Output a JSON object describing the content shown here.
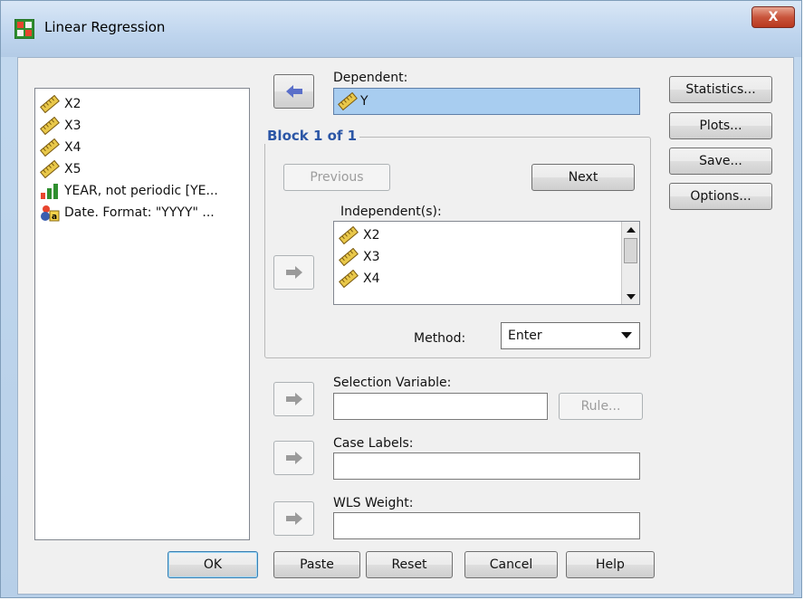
{
  "window": {
    "title": "Linear Regression",
    "close_glyph": "X"
  },
  "source_list": {
    "items": [
      {
        "label": "X2",
        "icon": "ruler-scale-icon"
      },
      {
        "label": "X3",
        "icon": "ruler-scale-icon"
      },
      {
        "label": "X4",
        "icon": "ruler-scale-icon"
      },
      {
        "label": "X5",
        "icon": "ruler-scale-icon"
      },
      {
        "label": "YEAR, not periodic [YE...",
        "icon": "ordinal-bar-icon"
      },
      {
        "label": "Date.  Format:  \"YYYY\" ...",
        "icon": "nominal-string-icon"
      }
    ]
  },
  "dependent": {
    "label": "Dependent:",
    "value": "Y"
  },
  "block": {
    "title": "Block 1 of 1",
    "previous_label": "Previous",
    "next_label": "Next",
    "independents_label": "Independent(s):",
    "independents": [
      "X2",
      "X3",
      "X4"
    ],
    "method_label": "Method:",
    "method_value": "Enter"
  },
  "selection": {
    "label": "Selection Variable:",
    "value": "",
    "rule_label": "Rule..."
  },
  "case_labels": {
    "label": "Case Labels:",
    "value": ""
  },
  "wls": {
    "label": "WLS Weight:",
    "value": ""
  },
  "side_buttons": {
    "statistics": "Statistics...",
    "plots": "Plots...",
    "save": "Save...",
    "options": "Options..."
  },
  "bottom_buttons": {
    "ok": "OK",
    "paste": "Paste",
    "reset": "Reset",
    "cancel": "Cancel",
    "help": "Help"
  },
  "colors": {
    "selected_field": "#a8cdf0",
    "group_title": "#2b56a6",
    "arrow_active": "#5a6fc9"
  }
}
